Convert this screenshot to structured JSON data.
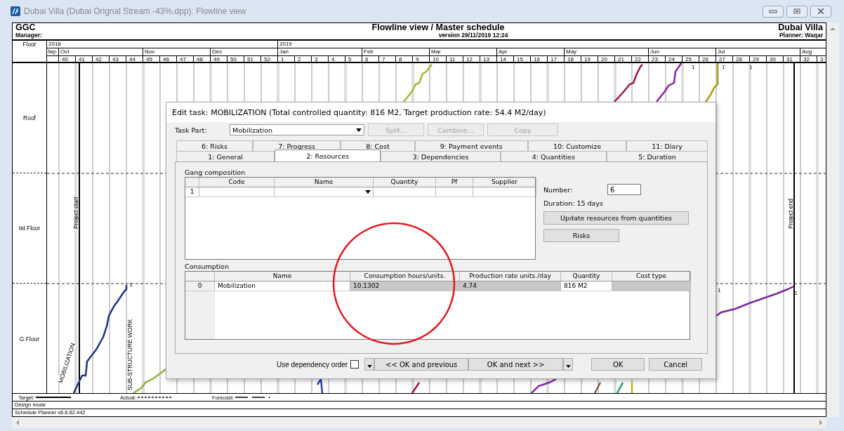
{
  "window": {
    "title": "Dubai Villa (Dubai Orignal Stream -43%.dpp): Flowline view"
  },
  "header": {
    "company": "GGC",
    "manager": "Manager:",
    "title": "Flowline view / Master schedule",
    "version": "version 29/11/2019 12:24",
    "project": "Dubai Villa",
    "planner": "Planner: Waqar"
  },
  "timeline": {
    "corner": "Floor",
    "years": [
      {
        "label": "2018",
        "months": [
          {
            "label": "Sep"
          },
          {
            "label": "Oct",
            "weeks": [
              "40",
              "41",
              "42",
              "43",
              "44"
            ]
          },
          {
            "label": "Nov",
            "weeks": [
              "45",
              "46",
              "47",
              "48"
            ]
          },
          {
            "label": "Dec",
            "weeks": [
              "49",
              "50",
              "51",
              "52"
            ]
          }
        ]
      },
      {
        "label": "2019",
        "months": [
          {
            "label": "Jan",
            "weeks": [
              "1",
              "2",
              "3",
              "4",
              "5"
            ]
          },
          {
            "label": "Feb",
            "weeks": [
              "6",
              "7",
              "8",
              "9"
            ]
          },
          {
            "label": "Mar",
            "weeks": [
              "10",
              "11",
              "12",
              "13"
            ]
          },
          {
            "label": "Apr",
            "weeks": [
              "14",
              "15",
              "16",
              "17"
            ]
          },
          {
            "label": "May",
            "weeks": [
              "18",
              "19",
              "20",
              "21",
              "22"
            ]
          },
          {
            "label": "Jun",
            "weeks": [
              "23",
              "24",
              "25",
              "26"
            ]
          },
          {
            "label": "Jul",
            "weeks": [
              "27",
              "28",
              "29",
              "30",
              "31"
            ]
          },
          {
            "label": "Aug",
            "weeks": [
              "32",
              "3"
            ]
          }
        ]
      }
    ]
  },
  "floors": [
    "Roof",
    "Ist Floor",
    "G Floor"
  ],
  "milestones": [
    {
      "label": "Project start",
      "kind": "start"
    },
    {
      "label": "Project end",
      "kind": "end"
    }
  ],
  "task_labels": [
    {
      "label": "MOBILIZATION",
      "kind": "slanted"
    },
    {
      "label": "SUB-STRUCTURE WORK",
      "kind": "vertical"
    }
  ],
  "flow_marks": [
    "1",
    "1",
    "1",
    "1",
    "1",
    "1"
  ],
  "legend": [
    {
      "label": "Target:",
      "kind": "solid"
    },
    {
      "label": "Actual:",
      "kind": "dotted"
    },
    {
      "label": "Forecast:",
      "kind": "dashed"
    }
  ],
  "status": [
    "Design mode",
    "Schedule Planner v6.6.82.442"
  ],
  "dialog": {
    "title": "Edit task: MOBILIZATION (Total controlled quantity: 816 M2, Target production rate: 54.4 M2/day)",
    "task_part": {
      "label": "Task Part:",
      "value": "Mobilization"
    },
    "part_buttons": [
      {
        "label": "Split...",
        "disabled": true
      },
      {
        "label": "Combine...",
        "disabled": true
      },
      {
        "label": "Copy",
        "disabled": true
      }
    ],
    "tabs_back": [
      {
        "label": "6: Risks",
        "selected": false
      },
      {
        "label": "7: Progress",
        "selected": false
      },
      {
        "label": "8: Cost",
        "selected": false
      },
      {
        "label": "9: Payment events",
        "selected": false
      },
      {
        "label": "10: Customize",
        "selected": false
      },
      {
        "label": "11: Diary",
        "selected": false
      }
    ],
    "tabs_front": [
      {
        "label": "1: General",
        "selected": false
      },
      {
        "label": "2: Resources",
        "selected": true
      },
      {
        "label": "3: Dependencies",
        "selected": false
      },
      {
        "label": "4: Quantities",
        "selected": false
      },
      {
        "label": "5: Duration",
        "selected": false
      }
    ],
    "gang": {
      "title": "Gang composition",
      "columns": [
        "Code",
        "Name",
        "Quantity",
        "Pf",
        "Supplier"
      ],
      "rows": [
        {
          "index": "1"
        }
      ]
    },
    "number": {
      "label": "Number:",
      "value": "6"
    },
    "duration": "Duration: 15 days",
    "side_buttons": [
      "Update resources from quantities",
      "Risks"
    ],
    "consumption": {
      "title": "Consumption",
      "columns": [
        {
          "label": "Name",
          "readonly": false
        },
        {
          "label": "Consumption hours/units.",
          "readonly": true
        },
        {
          "label": "Production rate units./day",
          "readonly": true
        },
        {
          "label": "Quantity",
          "readonly": false
        },
        {
          "label": "Cost type",
          "readonly": true
        }
      ],
      "rows": [
        {
          "index": "0",
          "cells": [
            "Mobilization",
            "10.1302",
            "4.74",
            "816 M2"
          ]
        }
      ]
    },
    "dependency_order": {
      "label": "Use dependency order",
      "checked": false
    },
    "nav_buttons": [
      "<< OK and previous",
      "OK and next >>"
    ],
    "buttons": [
      "OK",
      "Cancel"
    ]
  }
}
